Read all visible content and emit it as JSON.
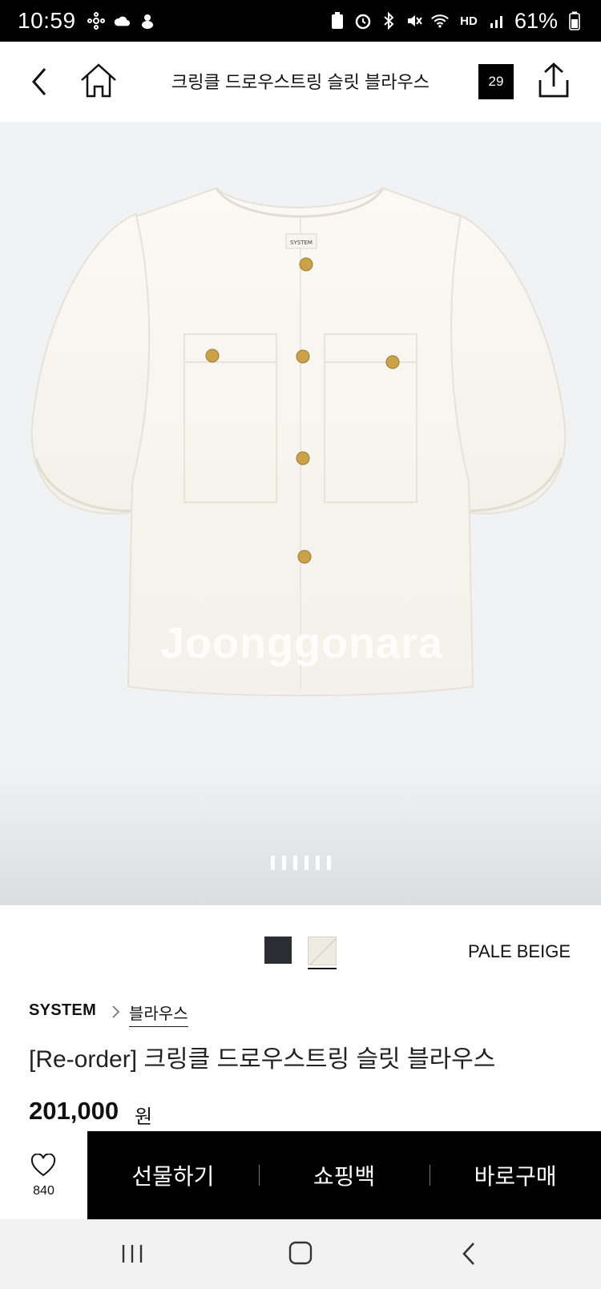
{
  "status_bar": {
    "time": "10:59",
    "battery": "61%",
    "hd_label": "HD",
    "icons_left": [
      "network-icon",
      "cloud-icon",
      "app-notification-icon"
    ],
    "icons_right": [
      "battery-saver-icon",
      "alarm-icon",
      "bluetooth-icon",
      "mute-icon",
      "wifi-icon",
      "hd-voice-icon",
      "signal-icon",
      "battery-icon"
    ]
  },
  "header": {
    "title": "크링클 드로우스트링 슬릿 블라우스",
    "count": "29",
    "icons": [
      "back-icon",
      "home-icon",
      "share-icon"
    ]
  },
  "gallery": {
    "watermark": "Joonggonara",
    "image_count": 6,
    "active_index": 0,
    "label_text": "SYSTEM"
  },
  "colors": {
    "selected_name": "PALE BEIGE",
    "options": [
      {
        "swatch": "#2b2d33"
      },
      {
        "swatch": "#eeebe3"
      }
    ]
  },
  "product": {
    "brand": "SYSTEM",
    "category": "블라우스",
    "name": "[Re-order] 크링클 드로우스트링 슬릿 블라우스",
    "price": "201,000",
    "currency": "원"
  },
  "actions": {
    "like_count": "840",
    "gift": "선물하기",
    "cart": "쇼핑백",
    "buy": "바로구매"
  }
}
